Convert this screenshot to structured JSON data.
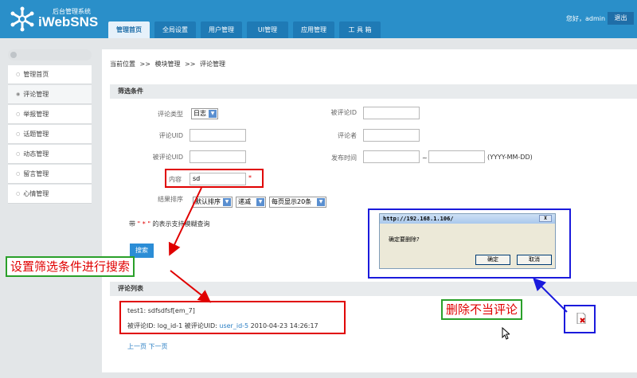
{
  "header": {
    "logo_sub": "后台管理系统",
    "logo_name": "iWebSNS",
    "greeting": "您好，admin",
    "logout": "退出",
    "tabs": [
      {
        "label": "管理首页",
        "active": true
      },
      {
        "label": "全局设置"
      },
      {
        "label": "用户管理"
      },
      {
        "label": "UI管理"
      },
      {
        "label": "应用管理"
      },
      {
        "label": "工 具 箱"
      }
    ]
  },
  "sidebar": {
    "items": [
      {
        "label": "管理首页"
      },
      {
        "label": "评论管理",
        "active": true
      },
      {
        "label": "举报管理"
      },
      {
        "label": "话题管理"
      },
      {
        "label": "动态管理"
      },
      {
        "label": "留言管理"
      },
      {
        "label": "心情管理"
      }
    ]
  },
  "breadcrumb": {
    "current": "当前位置",
    "sep": ">>",
    "item1": "模块管理",
    "item2": "评论管理"
  },
  "filter": {
    "title": "筛选条件",
    "type_label": "评论类型",
    "type_value": "日志",
    "commented_id_label": "被评论ID",
    "uid_label": "评论UID",
    "commenter_label": "评论者",
    "commented_uid_label": "被评论UID",
    "publish_time_label": "发布时间",
    "date_sep": "~",
    "date_hint": "(YYYY-MM-DD)",
    "content_label": "内容",
    "content_value": "sd",
    "required_mark": "*",
    "sort_label": "结果排序",
    "sort_value": "默认排序",
    "order_value": "递减",
    "pagesize_value": "每页显示20条",
    "fuzzy_note_prefix": "带",
    "fuzzy_note_star": "\" * \"",
    "fuzzy_note_suffix": "的表示支持模糊查询",
    "search_button": "搜索"
  },
  "list": {
    "title": "评论列表",
    "comment_text": "test1:  sdfsdfsf[em_7]",
    "meta_prefix": "被评论ID: log_id-1 被评论UID: ",
    "meta_uid": "user_id-5",
    "meta_time": "2010-04-23 14:26:17",
    "pager_prev": "上一页",
    "pager_next": "下一页"
  },
  "dialog": {
    "title": "http://192.168.1.106/",
    "close": "X",
    "message": "确定要删除?",
    "ok": "确定",
    "cancel": "取消"
  },
  "annotations": {
    "filter_callout": "设置筛选条件进行搜索",
    "delete_callout": "删除不当评论"
  },
  "colors": {
    "header_bg": "#2a8fc9",
    "callout_red": "#e00000",
    "callout_border_green": "#2aa02a",
    "callout_border_blue": "#1a1adc"
  }
}
